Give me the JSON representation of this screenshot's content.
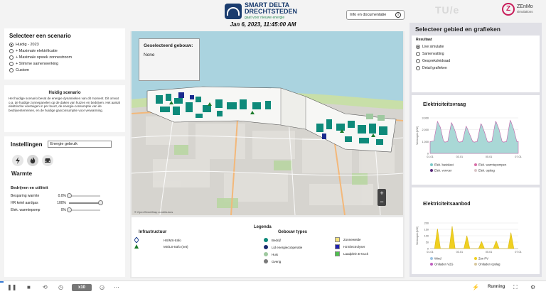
{
  "header": {
    "logo_line1": "SMART DELTA",
    "logo_line2": "DRECHTSTEDEN",
    "logo_tagline": "gaat voor nieuwe energie",
    "datetime": "Jan 6, 2023, 11:45:00 AM",
    "info_button": "Info en documentatie",
    "tu_logo": "TU/e",
    "zenmo_name": "ZEnMo",
    "zenmo_sub": "simulations"
  },
  "scenario": {
    "title": "Selecteer een scenario",
    "options": [
      "Huidig - 2023",
      "+ Maximale elektrificatie",
      "+ Maximale opwek zonnestroom",
      "+ Slimme samenwerking",
      "Custom"
    ],
    "selected": 0
  },
  "description": {
    "title": "Huidig scenario",
    "text": "Het huidige scenario bevat de energie dynamieken van dit moment. Dit omvat o.a. de huidige zonnepanelen op de daken van huizen en bedrijven. Het aantal elektrische voertuigen in per buurt, de energie-consumptie van de bedrijventerreinen, en de huidige gasconsumptie voor verwarming."
  },
  "settings": {
    "title": "Instellingen",
    "dropdown_value": "Energie gebruik",
    "icons": [
      "lightning-icon",
      "flame-icon",
      "car-icon"
    ],
    "section_title": "Warmte",
    "subsection_title": "Bedrijven en utiliteit",
    "sliders": [
      {
        "label": "Besparing warmte",
        "value": "0.0%",
        "level": 0.0
      },
      {
        "label": "HR ketel aardgas",
        "value": "100%",
        "level": 1.0
      },
      {
        "label": "Elek. warmtepomp",
        "value": "0%",
        "level": 0.0
      }
    ]
  },
  "map": {
    "selected_title": "Geselecteerd gebouw:",
    "selected_value": "None",
    "zoom_in": "+",
    "zoom_out": "−",
    "attribution": "© OpenStreetMap contributors"
  },
  "legend": {
    "title": "Legenda",
    "infra_title": "Infrastructuur",
    "infra_items": [
      {
        "label": "HS/MS-trafo",
        "color": "#1a3c8c"
      },
      {
        "label": "MS/LS-trafo (net)",
        "color": "#1a7a2a"
      }
    ],
    "building_title": "Gebouw types",
    "building_items": [
      {
        "label": "Bedrijf",
        "color": "#0e8a7a"
      },
      {
        "label": "Lid energiecoöperatie",
        "color": "#1a2a6e"
      },
      {
        "label": "Huis",
        "color": "#9fc9a0"
      },
      {
        "label": "Overig",
        "color": "#7a7a7a"
      }
    ],
    "other_items": [
      {
        "label": "Zonneweide",
        "color": "#f5e27a"
      },
      {
        "label": "H2 Electrolyser",
        "color": "#2020b0"
      },
      {
        "label": "Laadplein E-truck",
        "color": "#4ec04e"
      }
    ]
  },
  "right_panel": {
    "title": "Selecteer gebied en grafieken",
    "result_label": "Resultaat",
    "result_options": [
      "Live simulatie",
      "Samenvatting",
      "Gespreksleidraad",
      "Detail grafieken"
    ],
    "result_selected": 0
  },
  "charts": {
    "demand_title": "Elektriciteitsvraag",
    "supply_title": "Elektriciteitsaanbod",
    "demand_legend": [
      {
        "label": "Elek. basislast",
        "color": "#7cc8c8"
      },
      {
        "label": "Elek. warmtepompen",
        "color": "#d86fa8"
      },
      {
        "label": "Elek. vervoer",
        "color": "#5a2a7a"
      },
      {
        "label": "Elek. opslag",
        "color": "#d9c6c8"
      }
    ],
    "supply_legend": [
      {
        "label": "Wind",
        "color": "#9cc4e4"
      },
      {
        "label": "Zon PV",
        "color": "#f0d020"
      },
      {
        "label": "Ontladen V2G",
        "color": "#c060c0"
      },
      {
        "label": "Ontladen opslag",
        "color": "#d8c8a0"
      }
    ]
  },
  "chart_data": [
    {
      "type": "area",
      "title": "Elektriciteitsvraag",
      "ylabel": "Vermogen [kW]",
      "xlabel": "",
      "x_ticks": [
        "01.01",
        "03.01",
        "05.01",
        "07.01"
      ],
      "y_ticks": [
        "0",
        "1,000",
        "2,000",
        "3,000"
      ],
      "ylim": [
        0,
        3000
      ],
      "series": [
        {
          "name": "Elek. basislast",
          "x": [
            0,
            0.25,
            0.5,
            0.7,
            0.9,
            1.0,
            1.2,
            1.45,
            1.5,
            1.7,
            1.9,
            2.0,
            2.2,
            2.45,
            2.5,
            2.7,
            2.9,
            3.0,
            3.2,
            3.45,
            3.5,
            3.7,
            3.9,
            4.0,
            4.2,
            4.45,
            4.5,
            4.7,
            4.9,
            5.0,
            5.2,
            5.45,
            5.5,
            5.7,
            5.9,
            6.0
          ],
          "values": [
            1000,
            1050,
            2700,
            2200,
            1100,
            950,
            1000,
            2600,
            2500,
            1900,
            1000,
            950,
            1000,
            2300,
            2200,
            1600,
            1000,
            950,
            1000,
            2500,
            2450,
            1800,
            1000,
            950,
            1000,
            2700,
            2650,
            2000,
            1000,
            950,
            1000,
            2800,
            2700,
            2000,
            1000,
            1000
          ]
        }
      ]
    },
    {
      "type": "area",
      "title": "Elektriciteitsaanbod",
      "ylabel": "Vermogen [kW]",
      "xlabel": "",
      "x_ticks": [
        "01.01",
        "03.01",
        "05.01",
        "07.01"
      ],
      "y_ticks": [
        "0",
        "50",
        "100",
        "150",
        "200"
      ],
      "ylim": [
        0,
        200
      ],
      "series": [
        {
          "name": "Zon PV",
          "x": [
            0.3,
            0.5,
            0.7,
            1.3,
            1.5,
            1.7,
            2.3,
            2.5,
            2.7,
            3.3,
            3.5,
            3.7,
            4.3,
            4.5,
            4.7,
            5.3,
            5.5,
            5.7
          ],
          "values": [
            0,
            155,
            0,
            0,
            175,
            0,
            0,
            100,
            0,
            0,
            55,
            0,
            0,
            60,
            0,
            0,
            125,
            0
          ]
        }
      ]
    }
  ],
  "bottom": {
    "speed": "x10",
    "status": "Running",
    "progress": 0.006
  }
}
